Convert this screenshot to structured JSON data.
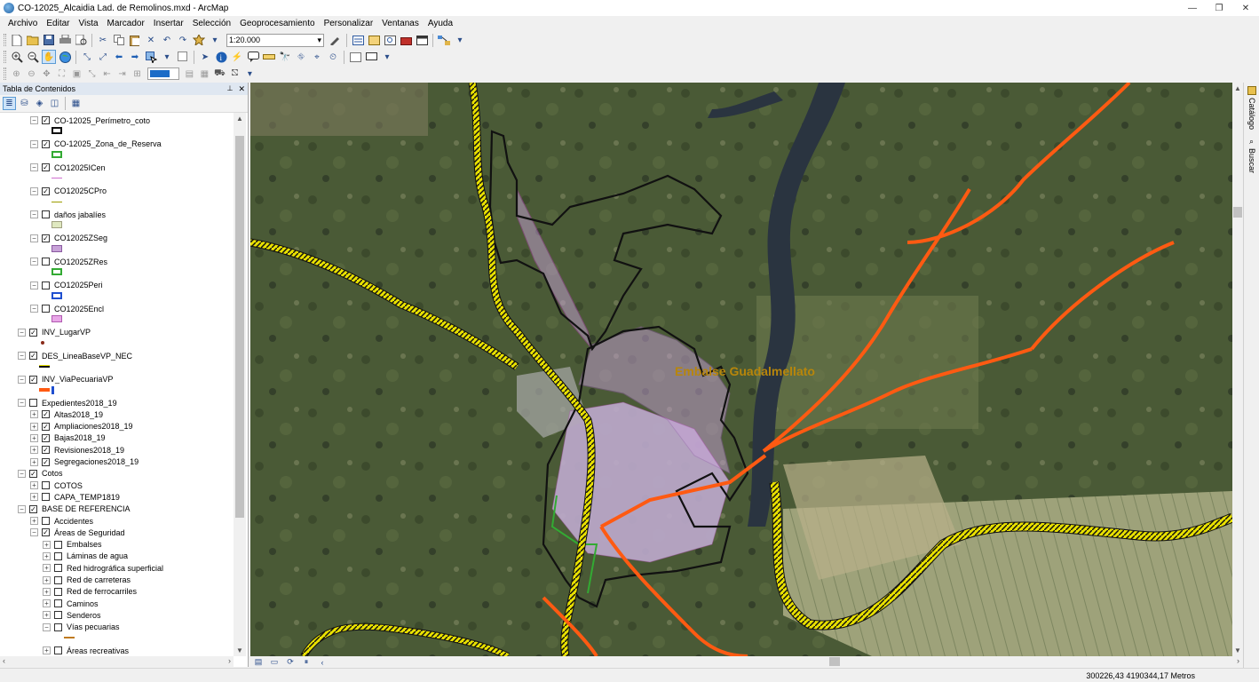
{
  "window": {
    "title": "CO-12025_Alcaidia Lad. de Remolinos.mxd - ArcMap",
    "minimize": "—",
    "maximize": "❐",
    "close": "✕"
  },
  "menu": [
    "Archivo",
    "Editar",
    "Vista",
    "Marcador",
    "Insertar",
    "Selección",
    "Geoprocesamiento",
    "Personalizar",
    "Ventanas",
    "Ayuda"
  ],
  "toolbar": {
    "scale": "1:20.000",
    "scale_arrow": "▾"
  },
  "toc": {
    "title": "Tabla de Contenidos",
    "pin": "📌",
    "close": "✕",
    "items": [
      {
        "label": "CO-12025_Perímetro_coto",
        "checked": true,
        "expanded": true,
        "indent": 1
      },
      {
        "label": "CO-12025_Zona_de_Reserva",
        "checked": true,
        "expanded": true,
        "indent": 1
      },
      {
        "label": "CO12025ICen",
        "checked": true,
        "expanded": true,
        "indent": 1
      },
      {
        "label": "CO12025CPro",
        "checked": true,
        "expanded": true,
        "indent": 1
      },
      {
        "label": "daños jabalíes",
        "checked": false,
        "expanded": true,
        "indent": 1
      },
      {
        "label": "CO12025ZSeg",
        "checked": true,
        "expanded": true,
        "indent": 1
      },
      {
        "label": "CO12025ZRes",
        "checked": false,
        "expanded": true,
        "indent": 1
      },
      {
        "label": "CO12025Peri",
        "checked": false,
        "expanded": true,
        "indent": 1
      },
      {
        "label": "CO12025Encl",
        "checked": false,
        "expanded": true,
        "indent": 1
      },
      {
        "label": "INV_LugarVP",
        "checked": true,
        "expanded": true,
        "indent": 0
      },
      {
        "label": "DES_LineaBaseVP_NEC",
        "checked": true,
        "expanded": true,
        "indent": 0
      },
      {
        "label": "INV_ViaPecuariaVP",
        "checked": true,
        "expanded": true,
        "indent": 0
      },
      {
        "label": "Expedientes2018_19",
        "checked": false,
        "expanded": true,
        "indent": 0
      },
      {
        "label": "Altas2018_19",
        "checked": true,
        "expanded": false,
        "indent": 1
      },
      {
        "label": "Ampliaciones2018_19",
        "checked": true,
        "expanded": false,
        "indent": 1
      },
      {
        "label": "Bajas2018_19",
        "checked": true,
        "expanded": false,
        "indent": 1
      },
      {
        "label": "Revisiones2018_19",
        "checked": true,
        "expanded": false,
        "indent": 1
      },
      {
        "label": "Segregaciones2018_19",
        "checked": true,
        "expanded": false,
        "indent": 1
      },
      {
        "label": "Cotos",
        "checked": true,
        "expanded": true,
        "indent": 0
      },
      {
        "label": "COTOS",
        "checked": false,
        "expanded": false,
        "indent": 1
      },
      {
        "label": "CAPA_TEMP1819",
        "checked": false,
        "expanded": false,
        "indent": 1
      },
      {
        "label": "BASE DE REFERENCIA",
        "checked": true,
        "expanded": true,
        "indent": 0
      },
      {
        "label": "Accidentes",
        "checked": false,
        "expanded": false,
        "indent": 1
      },
      {
        "label": "Áreas de Seguridad",
        "checked": true,
        "expanded": true,
        "indent": 1
      },
      {
        "label": "Embalses",
        "checked": false,
        "expanded": false,
        "indent": 2
      },
      {
        "label": "Láminas de agua",
        "checked": false,
        "expanded": false,
        "indent": 2
      },
      {
        "label": "Red hidrográfica superficial",
        "checked": false,
        "expanded": false,
        "indent": 2
      },
      {
        "label": "Red de carreteras",
        "checked": false,
        "expanded": false,
        "indent": 2
      },
      {
        "label": "Red de ferrocarriles",
        "checked": false,
        "expanded": false,
        "indent": 2
      },
      {
        "label": "Caminos",
        "checked": false,
        "expanded": false,
        "indent": 2
      },
      {
        "label": "Senderos",
        "checked": false,
        "expanded": false,
        "indent": 2
      },
      {
        "label": "Vías pecuarias",
        "checked": false,
        "expanded": true,
        "indent": 2
      },
      {
        "label": "Áreas recreativas",
        "checked": false,
        "expanded": false,
        "indent": 2
      }
    ]
  },
  "map": {
    "label": "Embalse Guadalmellato",
    "label_color": "#b8860b"
  },
  "dock": {
    "catalog": "Catálogo",
    "search": "Buscar"
  },
  "status": {
    "coords": "300226,43  4190344,17 Metros"
  },
  "colors": {
    "road": "#ff5a12",
    "livestock_path": "#e8e000",
    "perimeter": "#111111",
    "security": "#c8a2d8",
    "river": "#2a3440"
  }
}
